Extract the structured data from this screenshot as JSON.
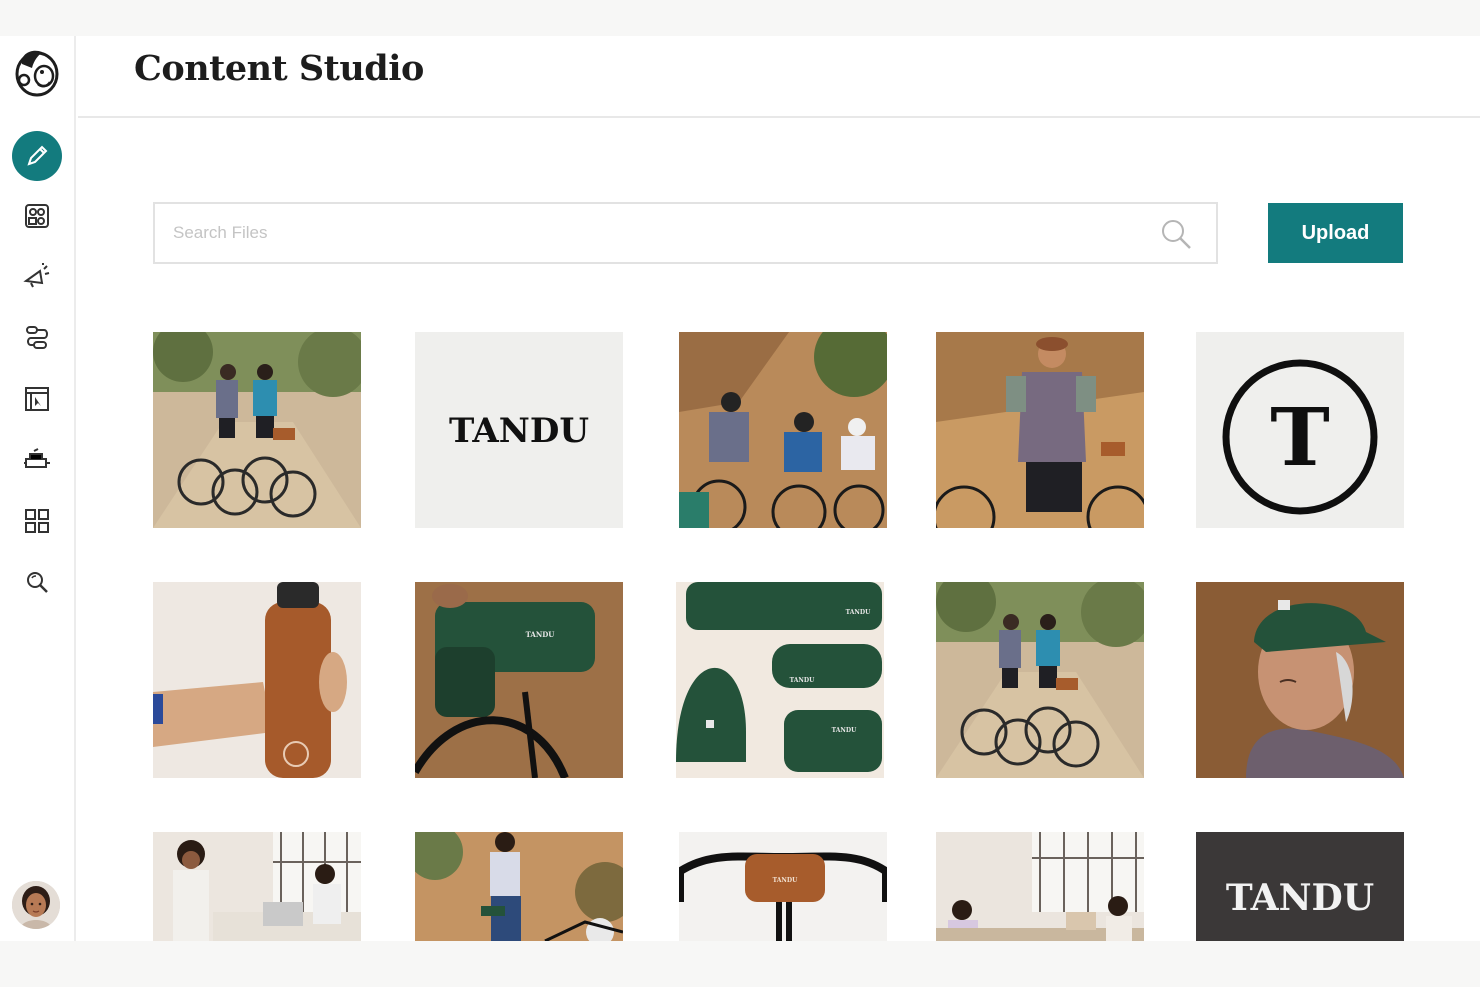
{
  "app": {
    "title": "Content Studio"
  },
  "sidebar": {
    "items": [
      {
        "name": "content-studio",
        "icon": "pencil-icon",
        "active": true
      },
      {
        "name": "audience",
        "icon": "audience-icon",
        "active": false
      },
      {
        "name": "campaigns",
        "icon": "megaphone-icon",
        "active": false
      },
      {
        "name": "automations",
        "icon": "automation-flow-icon",
        "active": false
      },
      {
        "name": "website",
        "icon": "website-icon",
        "active": false
      },
      {
        "name": "integrations",
        "icon": "integrations-icon",
        "active": false
      },
      {
        "name": "apps",
        "icon": "grid-icon",
        "active": false
      },
      {
        "name": "search",
        "icon": "search-icon",
        "active": false
      }
    ]
  },
  "search": {
    "placeholder": "Search Files",
    "value": ""
  },
  "toolbar": {
    "upload_label": "Upload"
  },
  "colors": {
    "accent": "#137b7e",
    "product_green": "#24523a",
    "product_brown": "#a75c2c",
    "dark_tile": "#3b3838"
  },
  "files": [
    {
      "kind": "photo",
      "subject": "two cyclists on trail"
    },
    {
      "kind": "logo",
      "label": "TANDU"
    },
    {
      "kind": "photo",
      "subject": "group riding"
    },
    {
      "kind": "photo",
      "subject": "cyclist standing"
    },
    {
      "kind": "logo-mark",
      "label": "T"
    },
    {
      "kind": "photo",
      "subject": "water bottle"
    },
    {
      "kind": "photo",
      "subject": "handlebar bag green",
      "label": "TANDU"
    },
    {
      "kind": "photo",
      "subject": "green products flatlay",
      "labels": [
        "TANDU",
        "TANDU",
        "TANDU"
      ]
    },
    {
      "kind": "photo",
      "subject": "two cyclists on trail"
    },
    {
      "kind": "photo",
      "subject": "portrait with cap"
    },
    {
      "kind": "photo",
      "subject": "office meeting"
    },
    {
      "kind": "photo",
      "subject": "rider with hip pack"
    },
    {
      "kind": "photo",
      "subject": "handlebar bag orange",
      "label": "TANDU"
    },
    {
      "kind": "photo",
      "subject": "office workspace"
    },
    {
      "kind": "logo",
      "label": "TANDU"
    }
  ]
}
